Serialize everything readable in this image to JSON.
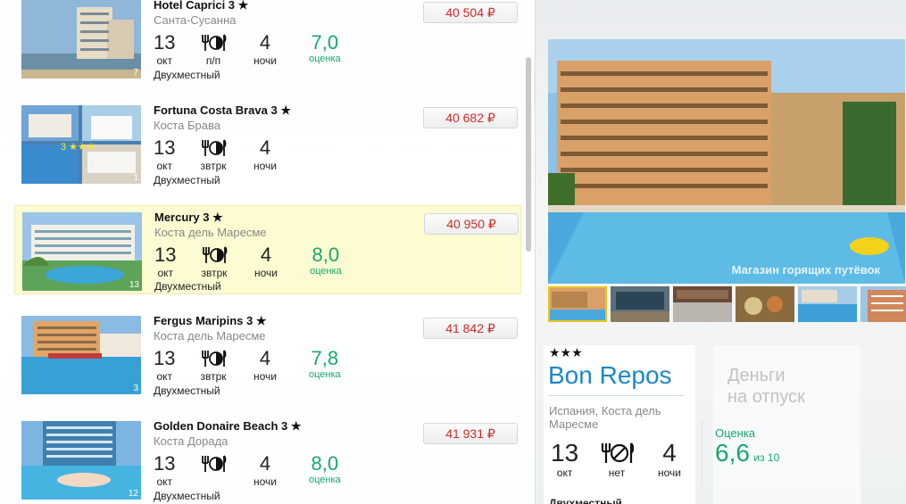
{
  "hotels": [
    {
      "name": "Hotel Caprici 3",
      "star_glyph": "★",
      "location": "Санта-Сусанна",
      "day": "13",
      "month": "окт",
      "meal": "п/п",
      "nights": "4",
      "nights_label": "ночи",
      "rating": "7,0",
      "rating_label": "оценка",
      "room": "Двухместный",
      "price": "40 504 ₽",
      "photo_count": "7"
    },
    {
      "name": "Fortuna Costa Brava 3",
      "star_glyph": "★",
      "location": "Коста Брава",
      "day": "13",
      "month": "окт",
      "meal": "звтрк",
      "nights": "4",
      "nights_label": "ночи",
      "rating": "",
      "rating_label": "",
      "room": "Двухместный",
      "price": "40 682 ₽",
      "photo_count": "1"
    },
    {
      "name": "Mercury 3",
      "star_glyph": "★",
      "location": "Коста дель Maресме",
      "day": "13",
      "month": "окт",
      "meal": "звтрк",
      "nights": "4",
      "nights_label": "ночи",
      "rating": "8,0",
      "rating_label": "оценка",
      "room": "Двухместный",
      "price": "40 950 ₽",
      "photo_count": "13"
    },
    {
      "name": "Fergus Maripins 3",
      "star_glyph": "★",
      "location": "Коста дель Maресме",
      "day": "13",
      "month": "окт",
      "meal": "звтрк",
      "nights": "4",
      "nights_label": "ночи",
      "rating": "7,8",
      "rating_label": "оценка",
      "room": "Двухместный",
      "price": "41 842 ₽",
      "photo_count": "3"
    },
    {
      "name": "Golden Donaire Beach 3",
      "star_glyph": "★",
      "location": "Коста Дорада",
      "day": "13",
      "month": "окт",
      "meal": "",
      "nights": "4",
      "nights_label": "ночи",
      "rating": "8,0",
      "rating_label": "оценка",
      "room": "Двухместный",
      "price": "41 931 ₽",
      "photo_count": "12"
    }
  ],
  "detail": {
    "stars": "★★★",
    "name": "Bon Repos",
    "location": "Испания, Коста дель Маресме",
    "day": "13",
    "month": "окт",
    "meal": "нет",
    "nights": "4",
    "nights_label": "ночи",
    "room": "Двухместный",
    "score_label": "Оценка",
    "score": "6,6",
    "score_of": "из 10",
    "watermark": "Магазин горящих путёвок"
  },
  "promo": {
    "line1": "Деньги",
    "line2": "на отпуск"
  },
  "colors": {
    "accent_blue": "#1e87c8",
    "price_red": "#cc2b2b",
    "rating_green": "#17a86d",
    "active_row": "#fdfbd2",
    "selected_thumb": "#f0c419"
  }
}
